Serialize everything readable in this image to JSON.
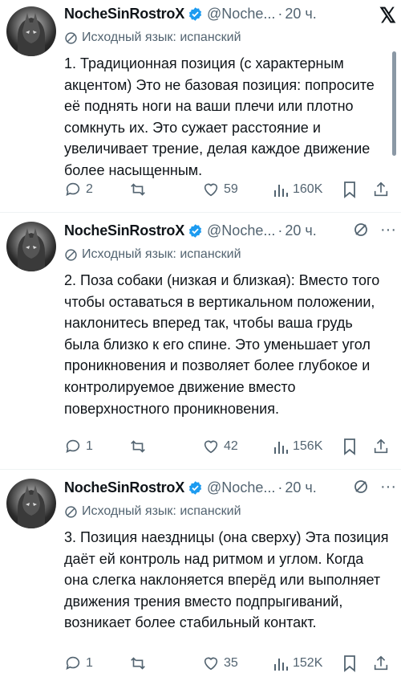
{
  "tweets": [
    {
      "name": "NocheSinRostroX",
      "handle": "@Noche...",
      "separator": "·",
      "time": "20 ч.",
      "translated_label": "Исходный язык: испанский",
      "text": "1. Традиционная позиция (с характерным акцентом) Это не базовая позиция: попросите её поднять ноги на ваши плечи или плотно сомкнуть их. Это сужает расстояние и увеличивает трение, делая каждое движение более насыщенным.",
      "replies": "2",
      "likes": "59",
      "views": "160K"
    },
    {
      "name": "NocheSinRostroX",
      "handle": "@Noche...",
      "separator": "·",
      "time": "20 ч.",
      "translated_label": "Исходный язык: испанский",
      "text": "2. Поза собаки (низкая и близкая): Вместо того чтобы оставаться в вертикальном положении, наклонитесь вперед так, чтобы ваша грудь была близко к его спине. Это уменьшает угол проникновения и позволяет более глубокое и контролируемое движение вместо поверхностного проникновения.",
      "replies": "1",
      "likes": "42",
      "views": "156K"
    },
    {
      "name": "NocheSinRostroX",
      "handle": "@Noche...",
      "separator": "·",
      "time": "20 ч.",
      "translated_label": "Исходный язык: испанский",
      "text": "3. Позиция наездницы (она сверху) Эта позиция даёт ей контроль над ритмом и углом. Когда она слегка наклоняется вперёд или выполняет движения трения вместо подпрыгиваний, возникает более стабильный контакт.",
      "replies": "1",
      "likes": "35",
      "views": "152K"
    }
  ],
  "more_label": "···",
  "colors": {
    "verified": "#1d9bf0",
    "secondary": "#536471",
    "text": "#0f1419"
  },
  "icons": [
    "x-logo-icon",
    "grok-icon",
    "more-icon",
    "translate-icon",
    "reply-icon",
    "repost-icon",
    "like-icon",
    "views-icon",
    "bookmark-icon",
    "share-icon",
    "verified-icon"
  ]
}
